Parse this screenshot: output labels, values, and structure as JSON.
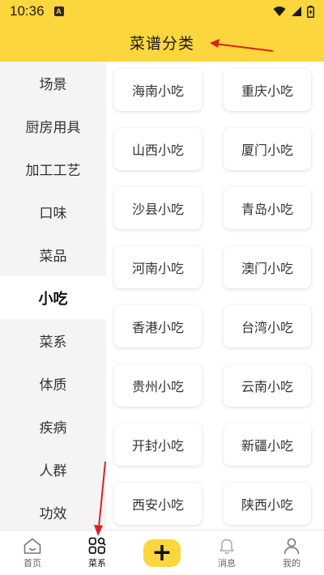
{
  "status_bar": {
    "time": "10:36",
    "notification_icon_letter": "A",
    "icons": [
      "wifi-icon",
      "signal-icon",
      "battery-icon"
    ]
  },
  "header": {
    "title": "菜谱分类"
  },
  "sidebar": {
    "items": [
      {
        "label": "场景"
      },
      {
        "label": "厨房用具"
      },
      {
        "label": "加工工艺"
      },
      {
        "label": "口味"
      },
      {
        "label": "菜品"
      },
      {
        "label": "小吃"
      },
      {
        "label": "菜系"
      },
      {
        "label": "体质"
      },
      {
        "label": "疾病"
      },
      {
        "label": "人群"
      },
      {
        "label": "功效"
      }
    ],
    "active_index": 5
  },
  "main": {
    "cards": [
      {
        "label": "海南小吃"
      },
      {
        "label": "重庆小吃"
      },
      {
        "label": "山西小吃"
      },
      {
        "label": "厦门小吃"
      },
      {
        "label": "沙县小吃"
      },
      {
        "label": "青岛小吃"
      },
      {
        "label": "河南小吃"
      },
      {
        "label": "澳门小吃"
      },
      {
        "label": "香港小吃"
      },
      {
        "label": "台湾小吃"
      },
      {
        "label": "贵州小吃"
      },
      {
        "label": "云南小吃"
      },
      {
        "label": "开封小吃"
      },
      {
        "label": "新疆小吃"
      },
      {
        "label": "西安小吃"
      },
      {
        "label": "陕西小吃"
      }
    ]
  },
  "tabbar": {
    "tabs": [
      {
        "label": "首页",
        "icon": "home-icon"
      },
      {
        "label": "菜系",
        "icon": "category-icon"
      },
      {
        "label": "",
        "icon": "plus-icon"
      },
      {
        "label": "消息",
        "icon": "bell-icon"
      },
      {
        "label": "我的",
        "icon": "user-icon"
      }
    ],
    "active_index": 1,
    "add_symbol": "+"
  },
  "colors": {
    "brand_yellow": "#fbd63c",
    "sidebar_bg": "#f4f4f4",
    "annotation_red": "#e02020"
  }
}
